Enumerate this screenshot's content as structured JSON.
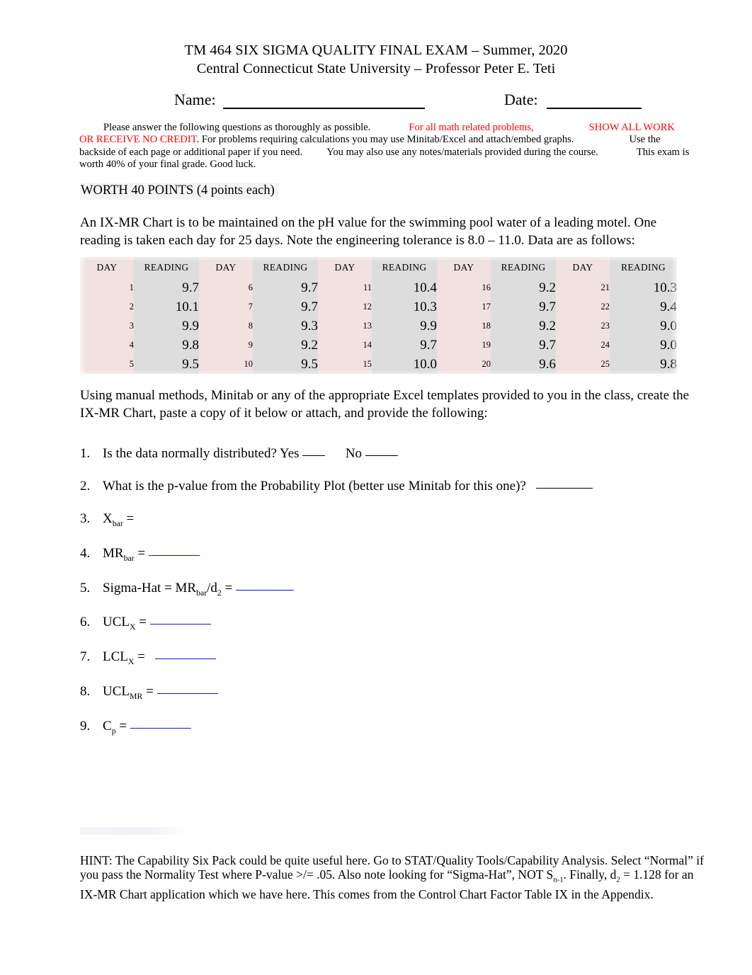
{
  "header": {
    "title_line1": "TM 464 SIX SIGMA QUALITY FINAL EXAM – Summer, 2020",
    "title_line2": "Central Connecticut State University – Professor Peter E. Teti"
  },
  "name_date": {
    "name_label": "Name:",
    "date_label": "Date:"
  },
  "instructions": {
    "seg1": "Please answer the following questions as thoroughly as possible.",
    "seg2_red": "For all math related problems,",
    "seg3_red": "SHOW ALL WORK OR RECEIVE NO CREDIT",
    "seg4": ".  For problems requiring calculations you may use Minitab/Excel and attach/embed graphs.",
    "seg5": "Use the backside of each page or additional paper if you need.",
    "seg6": "You may also use any notes/materials provided during the course.",
    "seg7": "This exam is worth 40% of your final grade.",
    "seg8": "Good luck.",
    "red_color": "#ff0000"
  },
  "worth": {
    "label": "WORTH 40 POINTS (4 points each)"
  },
  "intro": {
    "text": " An IX-MR Chart is to be maintained on the pH value for the swimming pool water of a leading motel.  One reading is taken each day for 25 days.  Note the engineering tolerance is 8.0 – 11.0.  Data are as follows:"
  },
  "table": {
    "headers": [
      "DAY",
      "READING",
      "DAY",
      "READING",
      "DAY",
      "READING",
      "DAY",
      "READING",
      "DAY",
      "READING"
    ],
    "day_header": "DAY",
    "reading_header": "READING",
    "day_bg": "#f1e1e1",
    "reading_bg": "#dddddd",
    "rows": [
      [
        "1",
        "9.7",
        "6",
        "9.7",
        "11",
        "10.4",
        "16",
        "9.2",
        "21",
        "10.3"
      ],
      [
        "2",
        "10.1",
        "7",
        "9.7",
        "12",
        "10.3",
        "17",
        "9.7",
        "22",
        "9.4"
      ],
      [
        "3",
        "9.9",
        "8",
        "9.3",
        "13",
        "9.9",
        "18",
        "9.2",
        "23",
        "9.0"
      ],
      [
        "4",
        "9.8",
        "9",
        "9.2",
        "14",
        "9.7",
        "19",
        "9.7",
        "24",
        "9.0"
      ],
      [
        "5",
        "9.5",
        "10",
        "9.5",
        "15",
        "10.0",
        "20",
        "9.6",
        "25",
        "9.8"
      ]
    ]
  },
  "after_table": {
    "text": "Using manual methods, Minitab or any of the appropriate Excel templates provided to you in the class, create the IX-MR Chart, paste a copy of it below or attach, and provide the following:"
  },
  "questions": [
    {
      "num": "1.",
      "text_a": "Is the data normally distributed?  Yes",
      "text_b": "No",
      "rule_color": "#000000"
    },
    {
      "num": "2.",
      "text_a": "What is the p-value from the Probability Plot (better use Minitab for this one)?",
      "rule_color": "#000000"
    },
    {
      "num": "3.",
      "text_main": "X",
      "sub": "bar",
      "text_after": " ="
    },
    {
      "num": "4.",
      "text_main": "MR",
      "sub": "bar",
      "text_after": " =",
      "rule_color": "#1111dd"
    },
    {
      "num": "5.",
      "text_pre": "Sigma-Hat = MR",
      "sub": "bar",
      "text_mid": "/d",
      "sub2": "2",
      "text_after": " =",
      "rule_color": "#1111dd"
    },
    {
      "num": "6.",
      "text_main": "UCL",
      "sub": "X",
      "text_after": " =",
      "rule_color": "#1111dd"
    },
    {
      "num": "7.",
      "text_main": "LCL",
      "sub": "X",
      "text_after": " =",
      "rule_color": "#1111dd"
    },
    {
      "num": "8.",
      "text_main": "UCL",
      "sub": "MR",
      "text_after": " =",
      "rule_color": "#1111dd"
    },
    {
      "num": "9.",
      "text_main": "C",
      "sub": "p",
      "text_after": " =",
      "rule_color": "#1111dd"
    }
  ],
  "hint": {
    "part1": "HINT:  The Capability Six Pack could be quite useful here.  Go to STAT/Quality Tools/Capability Analysis.  Select “Normal” if you pass the Normality Test where P-value >/= .05.   Also note looking for “Sigma-Hat”, NOT S",
    "sub1": "n-1",
    "part2": ".  Finally, d",
    "sub2": "2",
    "part3": " = 1.128 for an IX-MR Chart application which we have here.  This comes from the Control Chart Factor Table IX in the Appendix."
  }
}
